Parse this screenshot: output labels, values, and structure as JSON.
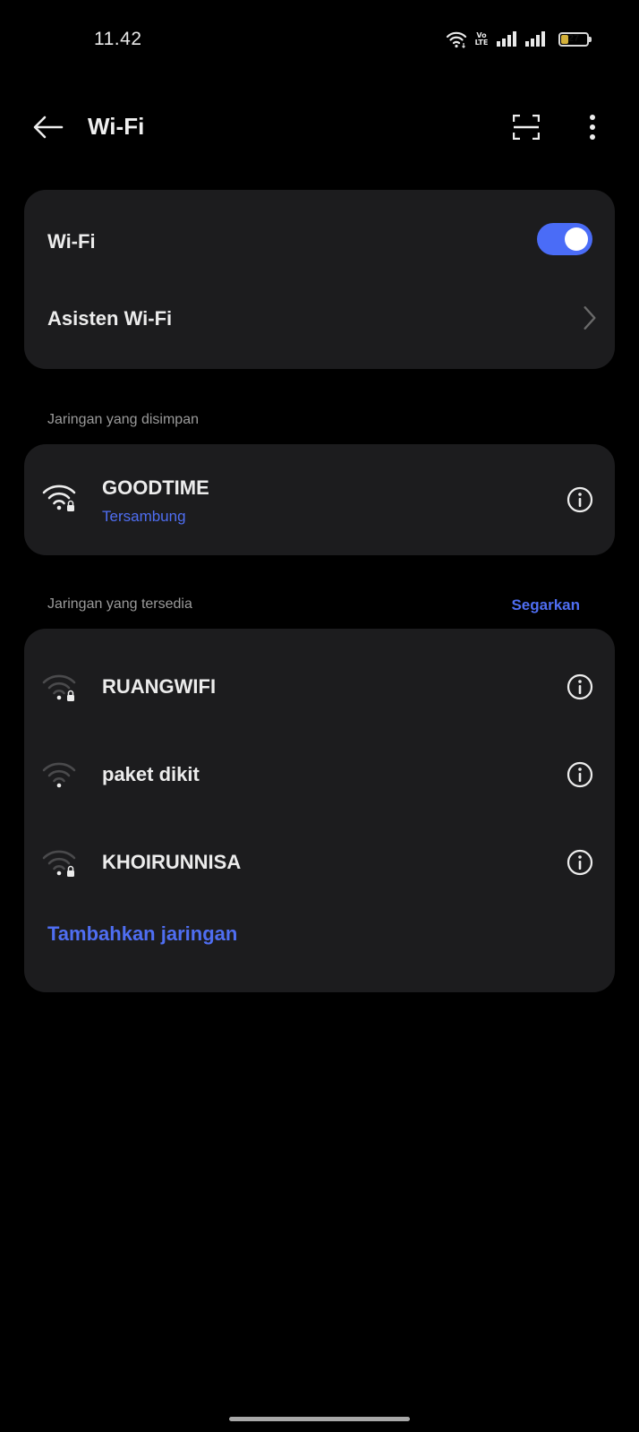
{
  "status_bar": {
    "time": "11.42",
    "volte_top": "Vo",
    "volte_bottom": "LTE",
    "battery_level": "27",
    "battery_fraction": 0.27,
    "battery_color": "#d4b13a",
    "icons": [
      "wifi-icon",
      "volte-icon",
      "signal-icon",
      "signal-icon",
      "battery-icon"
    ]
  },
  "app_bar": {
    "title": "Wi-Fi",
    "back_icon": "back-arrow-icon",
    "scan_icon": "scan-qr-icon",
    "more_icon": "more-vertical-icon"
  },
  "wifi_card": {
    "toggle_label": "Wi-Fi",
    "toggle_on": true,
    "assistant_label": "Asisten Wi-Fi"
  },
  "saved_section": {
    "header": "Jaringan yang disimpan",
    "networks": [
      {
        "name": "GOODTIME",
        "status": "Tersambung",
        "secured": true,
        "signal": "full"
      }
    ]
  },
  "available_section": {
    "header": "Jaringan yang tersedia",
    "refresh_label": "Segarkan",
    "networks": [
      {
        "name": "RUANGWIFI",
        "secured": true,
        "signal": "low"
      },
      {
        "name": "paket dikit",
        "secured": false,
        "signal": "low"
      },
      {
        "name": "KHOIRUNNISA",
        "secured": true,
        "signal": "low"
      }
    ],
    "add_network_label": "Tambahkan jaringan"
  },
  "colors": {
    "accent": "#4f6ef2",
    "toggle_on": "#4a6cf7",
    "card_bg": "#1c1c1e",
    "background": "#000000",
    "section_header": "#9a9a9a"
  }
}
